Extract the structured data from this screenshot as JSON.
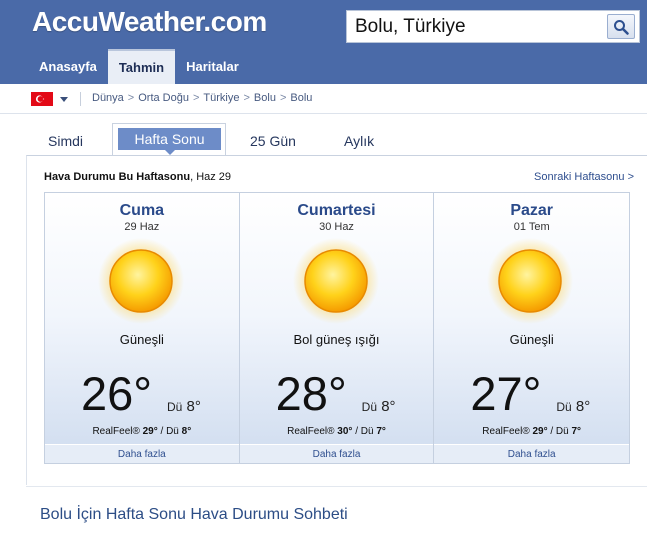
{
  "header": {
    "logo": "AccuWeather.com",
    "search_value": "Bolu, Türkiye",
    "search_icon": "search-icon",
    "nav": [
      {
        "label": "Anasayfa",
        "active": false
      },
      {
        "label": "Tahmin",
        "active": true
      },
      {
        "label": "Haritalar",
        "active": false
      }
    ],
    "colors": {
      "bar": "#4a6aa8",
      "active_tab": "#e9eef6"
    }
  },
  "breadcrumb": {
    "flag_icon": "turkey-flag-icon",
    "items": [
      "Dünya",
      "Orta Doğu",
      "Türkiye",
      "Bolu",
      "Bolu"
    ],
    "separator": ">"
  },
  "tabs": [
    {
      "label": "Simdi",
      "active": false
    },
    {
      "label": "Hafta Sonu",
      "active": true
    },
    {
      "label": "25 Gün",
      "active": false
    },
    {
      "label": "Aylık",
      "active": false
    }
  ],
  "panel": {
    "title_bold": "Hava Durumu Bu Haftasonu",
    "title_suffix": ", Haz 29",
    "next_link": "Sonraki Haftasonu >",
    "days": [
      {
        "name": "Cuma",
        "date": "29 Haz",
        "icon": "sunny-icon",
        "condition": "Güneşli",
        "high": "26°",
        "low_label": "Dü",
        "low": "8°",
        "realfeel_label": "RealFeel®",
        "realfeel_high": "29°",
        "realfeel_sep": " / Dü ",
        "realfeel_low": "8°",
        "more": "Daha fazla"
      },
      {
        "name": "Cumartesi",
        "date": "30 Haz",
        "icon": "sunny-icon",
        "condition": "Bol güneş ışığı",
        "high": "28°",
        "low_label": "Dü",
        "low": "8°",
        "realfeel_label": "RealFeel®",
        "realfeel_high": "30°",
        "realfeel_sep": " / Dü ",
        "realfeel_low": "7°",
        "more": "Daha fazla"
      },
      {
        "name": "Pazar",
        "date": "01 Tem",
        "icon": "sunny-icon",
        "condition": "Güneşli",
        "high": "27°",
        "low_label": "Dü",
        "low": "8°",
        "realfeel_label": "RealFeel®",
        "realfeel_high": "29°",
        "realfeel_sep": " / Dü ",
        "realfeel_low": "7°",
        "more": "Daha fazla"
      }
    ]
  },
  "bottom_title": "Bolu İçin Hafta Sonu Hava Durumu Sohbeti"
}
